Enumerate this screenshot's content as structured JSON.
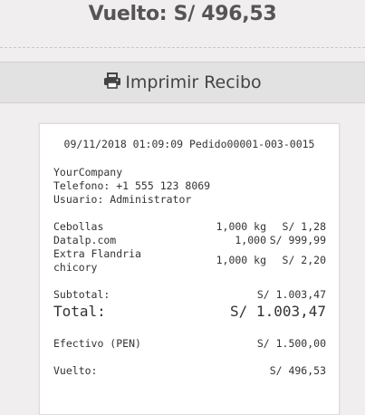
{
  "header": {
    "change_label": "Vuelto: S/ 496,53"
  },
  "print_button": {
    "label": "Imprimir Recibo",
    "icon": "printer-icon"
  },
  "receipt": {
    "header_line": "09/11/2018 01:09:09 Pedido00001-003-0015",
    "company": "YourCompany",
    "phone": "Telefono: +1 555 123 8069",
    "user": "Usuario: Administrator",
    "items": [
      {
        "name": "Cebollas",
        "qty": "1,000 kg",
        "price": "S/ 1,28"
      },
      {
        "name": "Datalp.com",
        "qty": "1,000",
        "price": "S/ 999,99"
      },
      {
        "name": "Extra Flandria\nchicory",
        "qty": "1,000 kg",
        "price": "S/ 2,20"
      }
    ],
    "subtotal_label": "Subtotal:",
    "subtotal_value": "S/ 1.003,47",
    "total_label": "Total:",
    "total_value": "S/ 1.003,47",
    "payment_label": "Efectivo (PEN)",
    "payment_value": "S/ 1.500,00",
    "change_label": "Vuelto:",
    "change_value": "S/ 496,53"
  }
}
